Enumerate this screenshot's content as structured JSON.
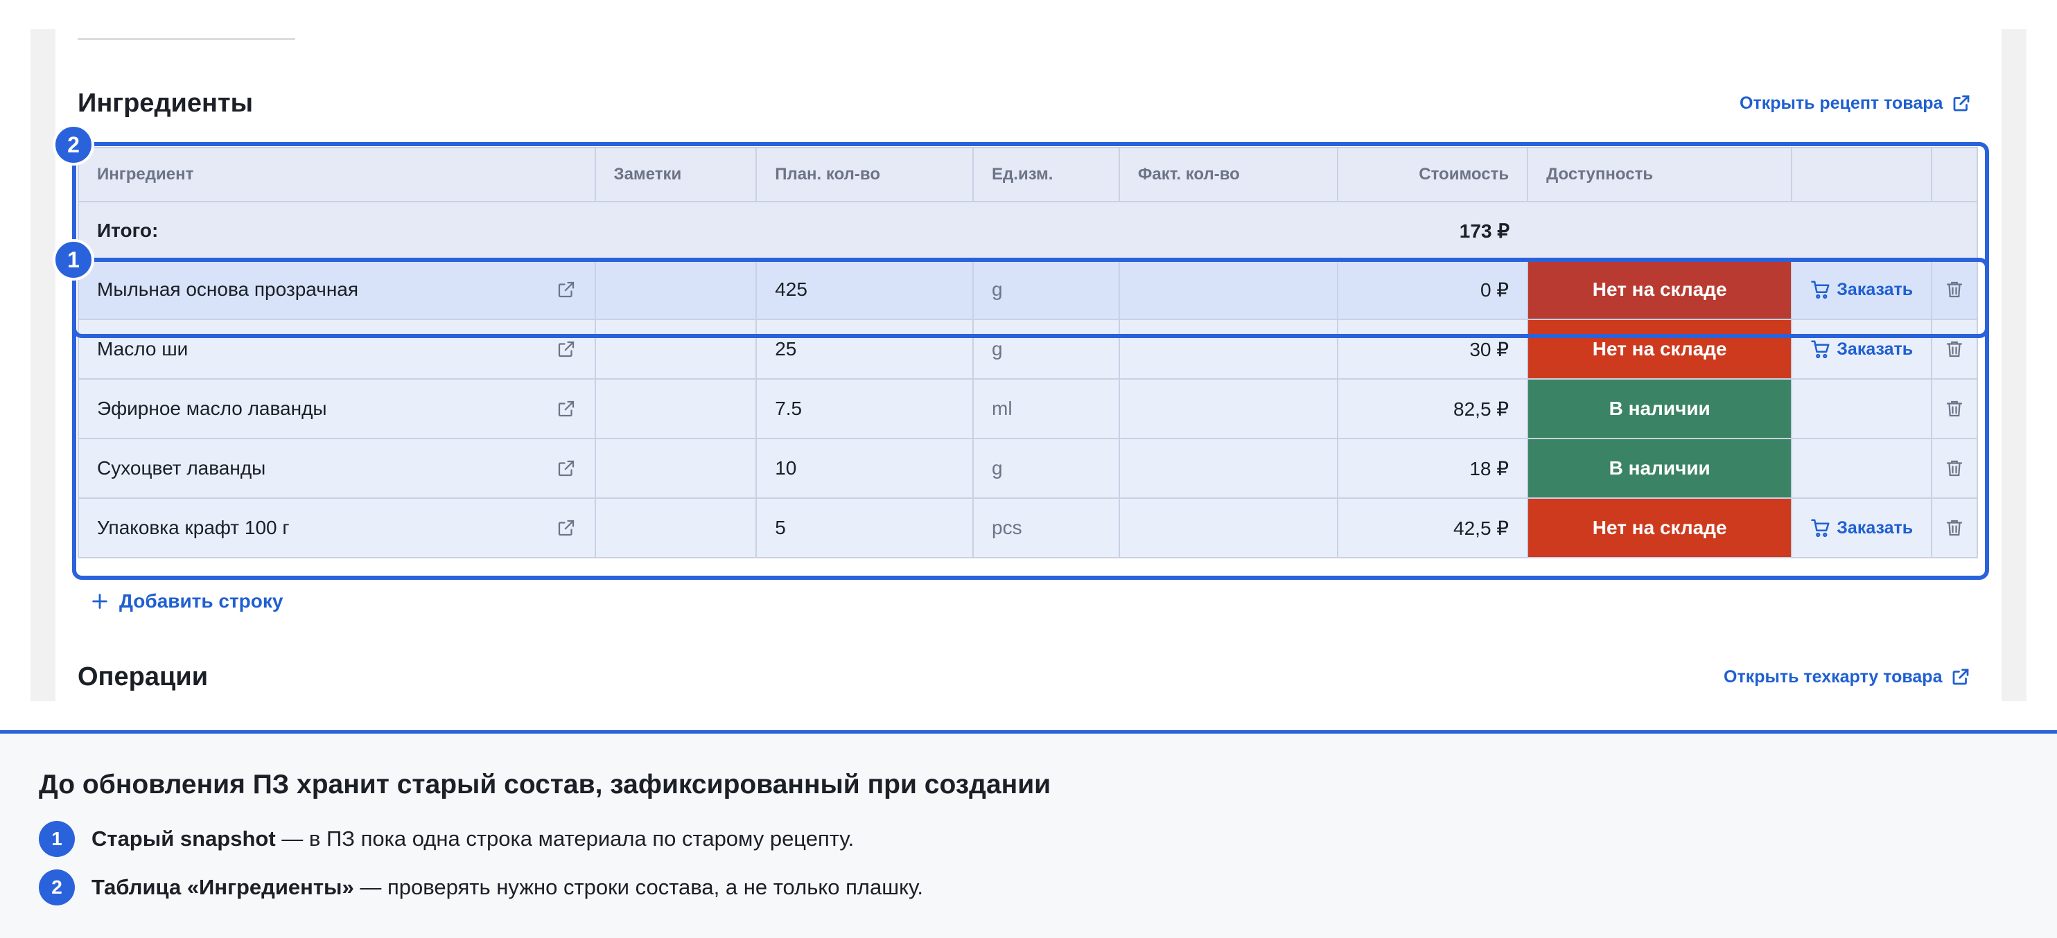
{
  "sections": {
    "ingredients_title": "Ингредиенты",
    "open_recipe_link": "Открыть рецепт товара",
    "operations_title": "Операции",
    "open_techcard_link": "Открыть техкарту товара"
  },
  "table": {
    "headers": [
      "Ингредиент",
      "Заметки",
      "План. кол-во",
      "Ед.изм.",
      "Факт. кол-во",
      "Стоимость",
      "Доступность",
      "",
      ""
    ],
    "total_label": "Итого:",
    "total_value": "173 ₽",
    "rows": [
      {
        "name": "Мыльная основа прозрачная",
        "notes": "",
        "plan": "425",
        "unit": "g",
        "fact": "",
        "cost": "0 ₽",
        "status": "Нет на складе",
        "order": "Заказать"
      },
      {
        "name": "Масло ши",
        "notes": "",
        "plan": "25",
        "unit": "g",
        "fact": "",
        "cost": "30 ₽",
        "status": "Нет на складе",
        "order": "Заказать"
      },
      {
        "name": "Эфирное масло лаванды",
        "notes": "",
        "plan": "7.5",
        "unit": "ml",
        "fact": "",
        "cost": "82,5 ₽",
        "status": "В наличии",
        "order": ""
      },
      {
        "name": "Сухоцвет лаванды",
        "notes": "",
        "plan": "10",
        "unit": "g",
        "fact": "",
        "cost": "18 ₽",
        "status": "В наличии",
        "order": ""
      },
      {
        "name": "Упаковка крафт 100 г",
        "notes": "",
        "plan": "5",
        "unit": "pcs",
        "fact": "",
        "cost": "42,5 ₽",
        "status": "Нет на складе",
        "order": "Заказать"
      }
    ],
    "add_row": "Добавить строку"
  },
  "badges": {
    "one": "1",
    "two": "2"
  },
  "panel": {
    "title": "До обновления ПЗ хранит старый состав, зафиксированный при создании",
    "notes": [
      {
        "num": "1",
        "bold": "Старый snapshot",
        "text": " — в ПЗ пока одна строка материала по старому рецепту."
      },
      {
        "num": "2",
        "bold": "Таблица «Ингредиенты»",
        "text": " — проверять нужно строки состава, а не только плашку."
      }
    ]
  },
  "colors": {
    "accent": "#2a62dc",
    "out_of_stock": "#cd3a1e",
    "in_stock": "#3a8465",
    "link": "#1f5fd1"
  }
}
